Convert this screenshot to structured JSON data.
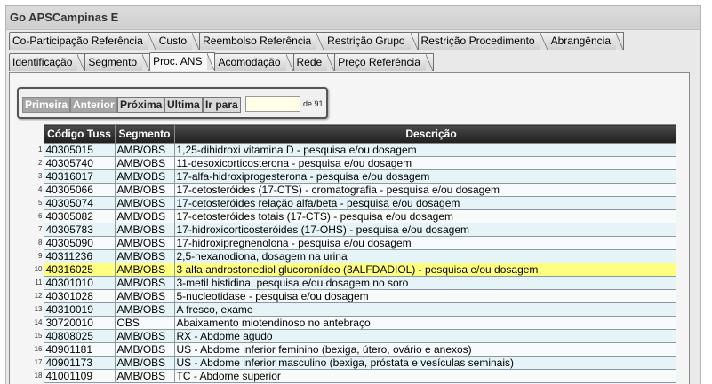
{
  "window": {
    "title": "Go APSCampinas E"
  },
  "tabs_row1": [
    {
      "label": "Co-Participação Referência"
    },
    {
      "label": "Custo"
    },
    {
      "label": "Reembolso Referência"
    },
    {
      "label": "Restrição Grupo"
    },
    {
      "label": "Restrição Procedimento"
    },
    {
      "label": "Abrangência"
    }
  ],
  "tabs_row2": [
    {
      "label": "Identificação"
    },
    {
      "label": "Segmento"
    },
    {
      "label": "Proc. ANS",
      "active": true
    },
    {
      "label": "Acomodação"
    },
    {
      "label": "Rede"
    },
    {
      "label": "Preço Referência"
    }
  ],
  "pager": {
    "first": "Primeira",
    "previous": "Anterior",
    "next": "Próxima",
    "last": "Ultima",
    "goto": "Ir para",
    "goto_value": "",
    "of_label": "de 91"
  },
  "table": {
    "headers": {
      "code": "Código Tuss",
      "segment": "Segmento",
      "description": "Descrição"
    },
    "rows": [
      {
        "n": "1",
        "code": "40305015",
        "segment": "AMB/OBS",
        "description": "1,25-dihidroxi vitamina D - pesquisa e/ou dosagem"
      },
      {
        "n": "2",
        "code": "40305740",
        "segment": "AMB/OBS",
        "description": "11-desoxicorticosterona - pesquisa e/ou dosagem"
      },
      {
        "n": "3",
        "code": "40316017",
        "segment": "AMB/OBS",
        "description": "17-alfa-hidroxiprogesterona - pesquisa e/ou dosagem"
      },
      {
        "n": "4",
        "code": "40305066",
        "segment": "AMB/OBS",
        "description": "17-cetosteróides (17-CTS) - cromatografia - pesquisa e/ou dosagem"
      },
      {
        "n": "5",
        "code": "40305074",
        "segment": "AMB/OBS",
        "description": "17-cetosteróides relação alfa/beta - pesquisa e/ou dosagem"
      },
      {
        "n": "6",
        "code": "40305082",
        "segment": "AMB/OBS",
        "description": "17-cetosteróides totais (17-CTS) - pesquisa e/ou dosagem"
      },
      {
        "n": "7",
        "code": "40305783",
        "segment": "AMB/OBS",
        "description": "17-hidroxicorticosteróides (17-OHS) - pesquisa e/ou dosagem"
      },
      {
        "n": "8",
        "code": "40305090",
        "segment": "AMB/OBS",
        "description": "17-hidroxipregnenolona - pesquisa e/ou dosagem"
      },
      {
        "n": "9",
        "code": "40311236",
        "segment": "AMB/OBS",
        "description": "2,5-hexanodiona, dosagem na urina"
      },
      {
        "n": "10",
        "code": "40316025",
        "segment": "AMB/OBS",
        "description": "3 alfa androstonediol glucoronídeo (3ALFDADIOL) - pesquisa e/ou dosagem",
        "selected": true
      },
      {
        "n": "11",
        "code": "40301010",
        "segment": "AMB/OBS",
        "description": "3-metil histidina, pesquisa e/ou dosagem no soro"
      },
      {
        "n": "12",
        "code": "40301028",
        "segment": "AMB/OBS",
        "description": "5-nucleotidase - pesquisa e/ou dosagem"
      },
      {
        "n": "13",
        "code": "40310019",
        "segment": "AMB/OBS",
        "description": "A fresco, exame"
      },
      {
        "n": "14",
        "code": "30720010",
        "segment": "OBS",
        "description": "Abaixamento miotendinoso no antebraço"
      },
      {
        "n": "15",
        "code": "40808025",
        "segment": "AMB/OBS",
        "description": "RX - Abdome agudo"
      },
      {
        "n": "16",
        "code": "40901181",
        "segment": "AMB/OBS",
        "description": "US - Abdome inferior feminino (bexiga, útero, ovário e anexos)"
      },
      {
        "n": "17",
        "code": "40901173",
        "segment": "AMB/OBS",
        "description": "US - Abdome inferior masculino (bexiga, próstata e vesículas seminais)"
      },
      {
        "n": "18",
        "code": "41001109",
        "segment": "AMB/OBS",
        "description": "TC - Abdome superior"
      }
    ]
  },
  "colors": {
    "selected_row": "#ffff80",
    "row_even": "#e6f4f8",
    "header_bg": "#2a2a2a"
  }
}
